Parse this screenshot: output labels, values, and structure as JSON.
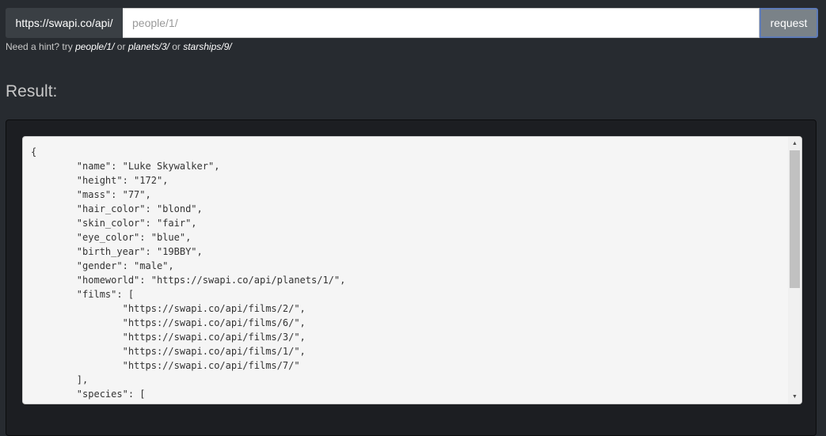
{
  "search": {
    "base_url": "https://swapi.co/api/",
    "placeholder": "people/1/",
    "button_label": "request"
  },
  "hint": {
    "prefix": "Need a hint? try",
    "examples": [
      "people/1/",
      "planets/3/",
      "starships/9/"
    ],
    "separator": "or"
  },
  "result": {
    "heading": "Result:",
    "json_text": "{\n\t\"name\": \"Luke Skywalker\",\n\t\"height\": \"172\",\n\t\"mass\": \"77\",\n\t\"hair_color\": \"blond\",\n\t\"skin_color\": \"fair\",\n\t\"eye_color\": \"blue\",\n\t\"birth_year\": \"19BBY\",\n\t\"gender\": \"male\",\n\t\"homeworld\": \"https://swapi.co/api/planets/1/\",\n\t\"films\": [\n\t\t\"https://swapi.co/api/films/2/\",\n\t\t\"https://swapi.co/api/films/6/\",\n\t\t\"https://swapi.co/api/films/3/\",\n\t\t\"https://swapi.co/api/films/1/\",\n\t\t\"https://swapi.co/api/films/7/\"\n\t],\n\t\"species\": ["
  },
  "icons": {
    "scroll_up": "scroll-up-arrow",
    "scroll_down": "scroll-down-arrow"
  },
  "colors": {
    "background": "#272b30",
    "addon": "#3a3f44",
    "button": "#7a8288",
    "button_border": "#5e7bb8",
    "well": "#1c1e22",
    "code_bg": "#f5f5f5"
  }
}
